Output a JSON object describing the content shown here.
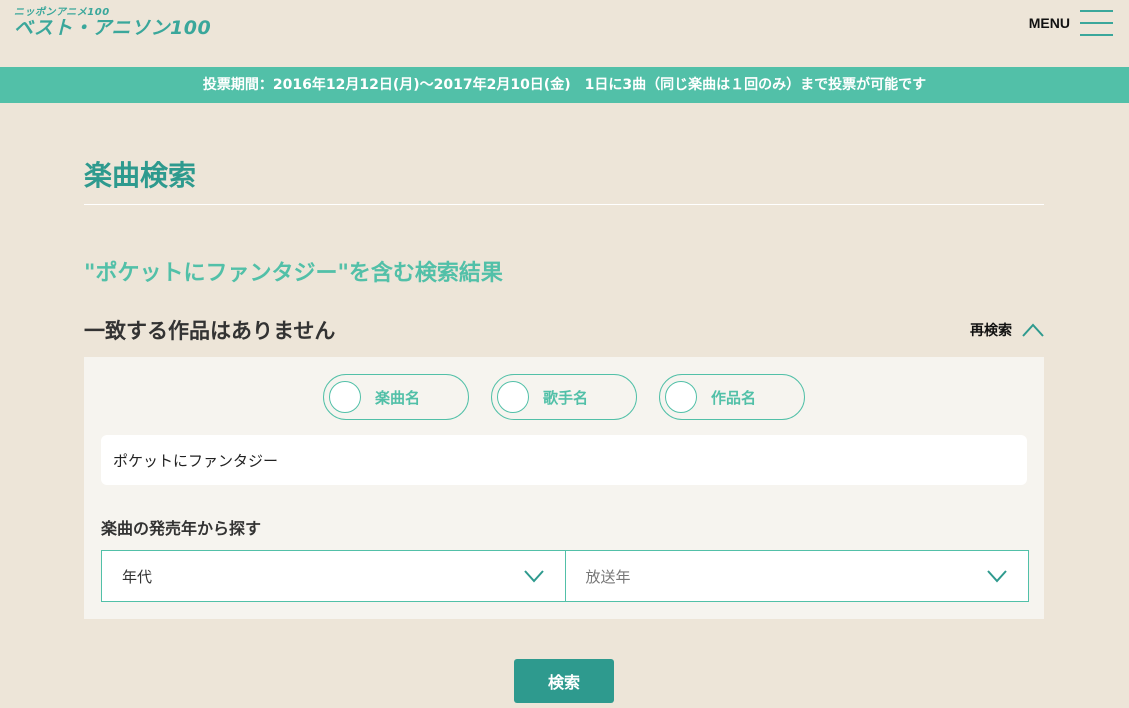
{
  "header": {
    "logo_sub": "ニッポンアニメ100",
    "logo_main": "ベスト・アニソン100",
    "menu_label": "MENU"
  },
  "banner": {
    "text": "投票期間：2016年12月12日(月)〜2017年2月10日(金)　1日に3曲（同じ楽曲は１回のみ）まで投票が可能です"
  },
  "page": {
    "title": "楽曲検索",
    "result_heading": "\"ポケットにファンタジー\"を含む検索結果",
    "no_result": "一致する作品はありません",
    "research_label": "再検索"
  },
  "search": {
    "radio_options": [
      {
        "label": "楽曲名"
      },
      {
        "label": "歌手名"
      },
      {
        "label": "作品名"
      }
    ],
    "query_value": "ポケットにファンタジー",
    "year_section_label": "楽曲の発売年から探す",
    "decade_select": "年代",
    "year_select_placeholder": "放送年",
    "submit_label": "検索"
  },
  "colors": {
    "background": "#ede5d8",
    "accent": "#52c0a8",
    "accent_dark": "#2e9a8e",
    "panel": "#f6f4ef"
  }
}
